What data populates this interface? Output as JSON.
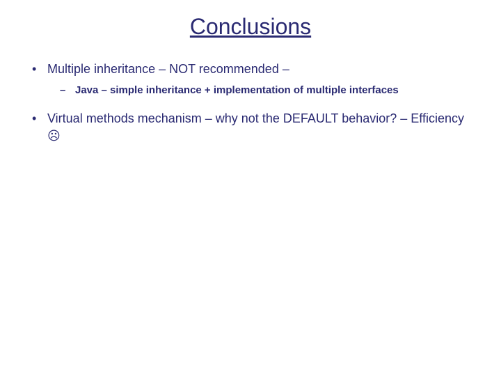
{
  "title": "Conclusions",
  "bullets": {
    "b0": {
      "text": "Multiple inheritance – NOT recommended –",
      "sub0": "Java – simple inheritance + implementation of multiple interfaces"
    },
    "b1": {
      "text": "Virtual methods mechanism – why not the DEFAULT behavior? – Efficiency ☹"
    }
  }
}
